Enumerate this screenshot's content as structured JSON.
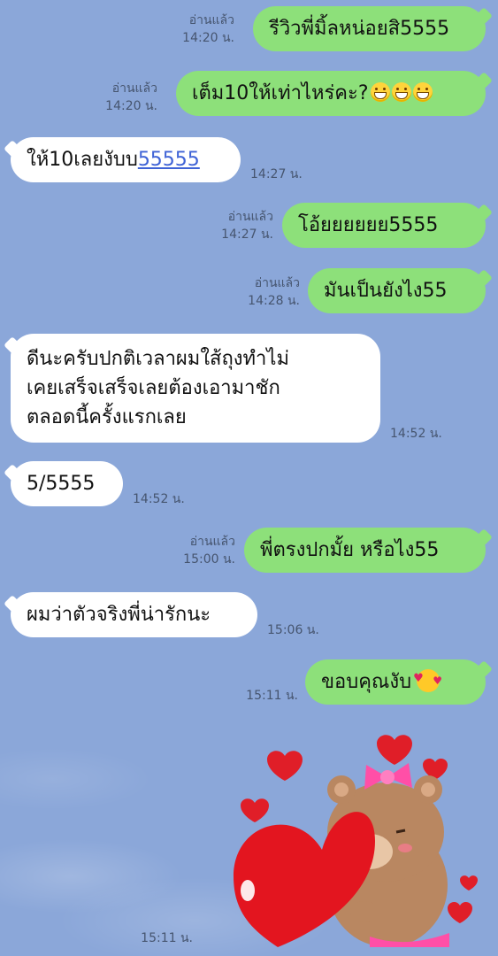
{
  "messages": [
    {
      "text": "รีวิวพี่มิ้ลหน่อยสิ5555",
      "read": "อ่านแล้ว",
      "time": "14:20 น."
    },
    {
      "text": "เต็ม10ให้เท่าไหร่คะ?",
      "read": "อ่านแล้ว",
      "time": "14:20 น."
    },
    {
      "text_prefix": "ให้10เลยงับบ",
      "text_link": "55555",
      "time": "14:27 น."
    },
    {
      "text": "โอ้ยยยยยย5555",
      "read": "อ่านแล้ว",
      "time": "14:27 น."
    },
    {
      "text": "มันเป็นยังไง55",
      "read": "อ่านแล้ว",
      "time": "14:28 น."
    },
    {
      "lines": [
        "ดีนะครับปกติเวลาผมใส้ถุงทำไม่",
        "เคยเสร็จเสร็จเลยต้องเอามาชัก",
        "ตลอดนี้ครั้งแรกเลย"
      ],
      "time": "14:52 น."
    },
    {
      "text": "5/5555",
      "time": "14:52 น."
    },
    {
      "text": "พี่ตรงปกมั้ย หรือไง55",
      "read": "อ่านแล้ว",
      "time": "15:00 น."
    },
    {
      "text": "ผมว่าตัวจริงพี่น่ารักนะ",
      "time": "15:06 น."
    },
    {
      "text": "ขอบคุณงับ",
      "time": "15:11 น."
    },
    {
      "sticker": "brown-bear-hugging-heart-sticker",
      "time": "15:11 น."
    }
  ],
  "icons": [
    "grin-emoji",
    "smiling-face-with-hearts-emoji",
    "heart-icon"
  ],
  "colors": {
    "background": "#8ba7d9",
    "outgoing": "#8de07a",
    "incoming": "#ffffff",
    "link": "#3f63d6"
  }
}
